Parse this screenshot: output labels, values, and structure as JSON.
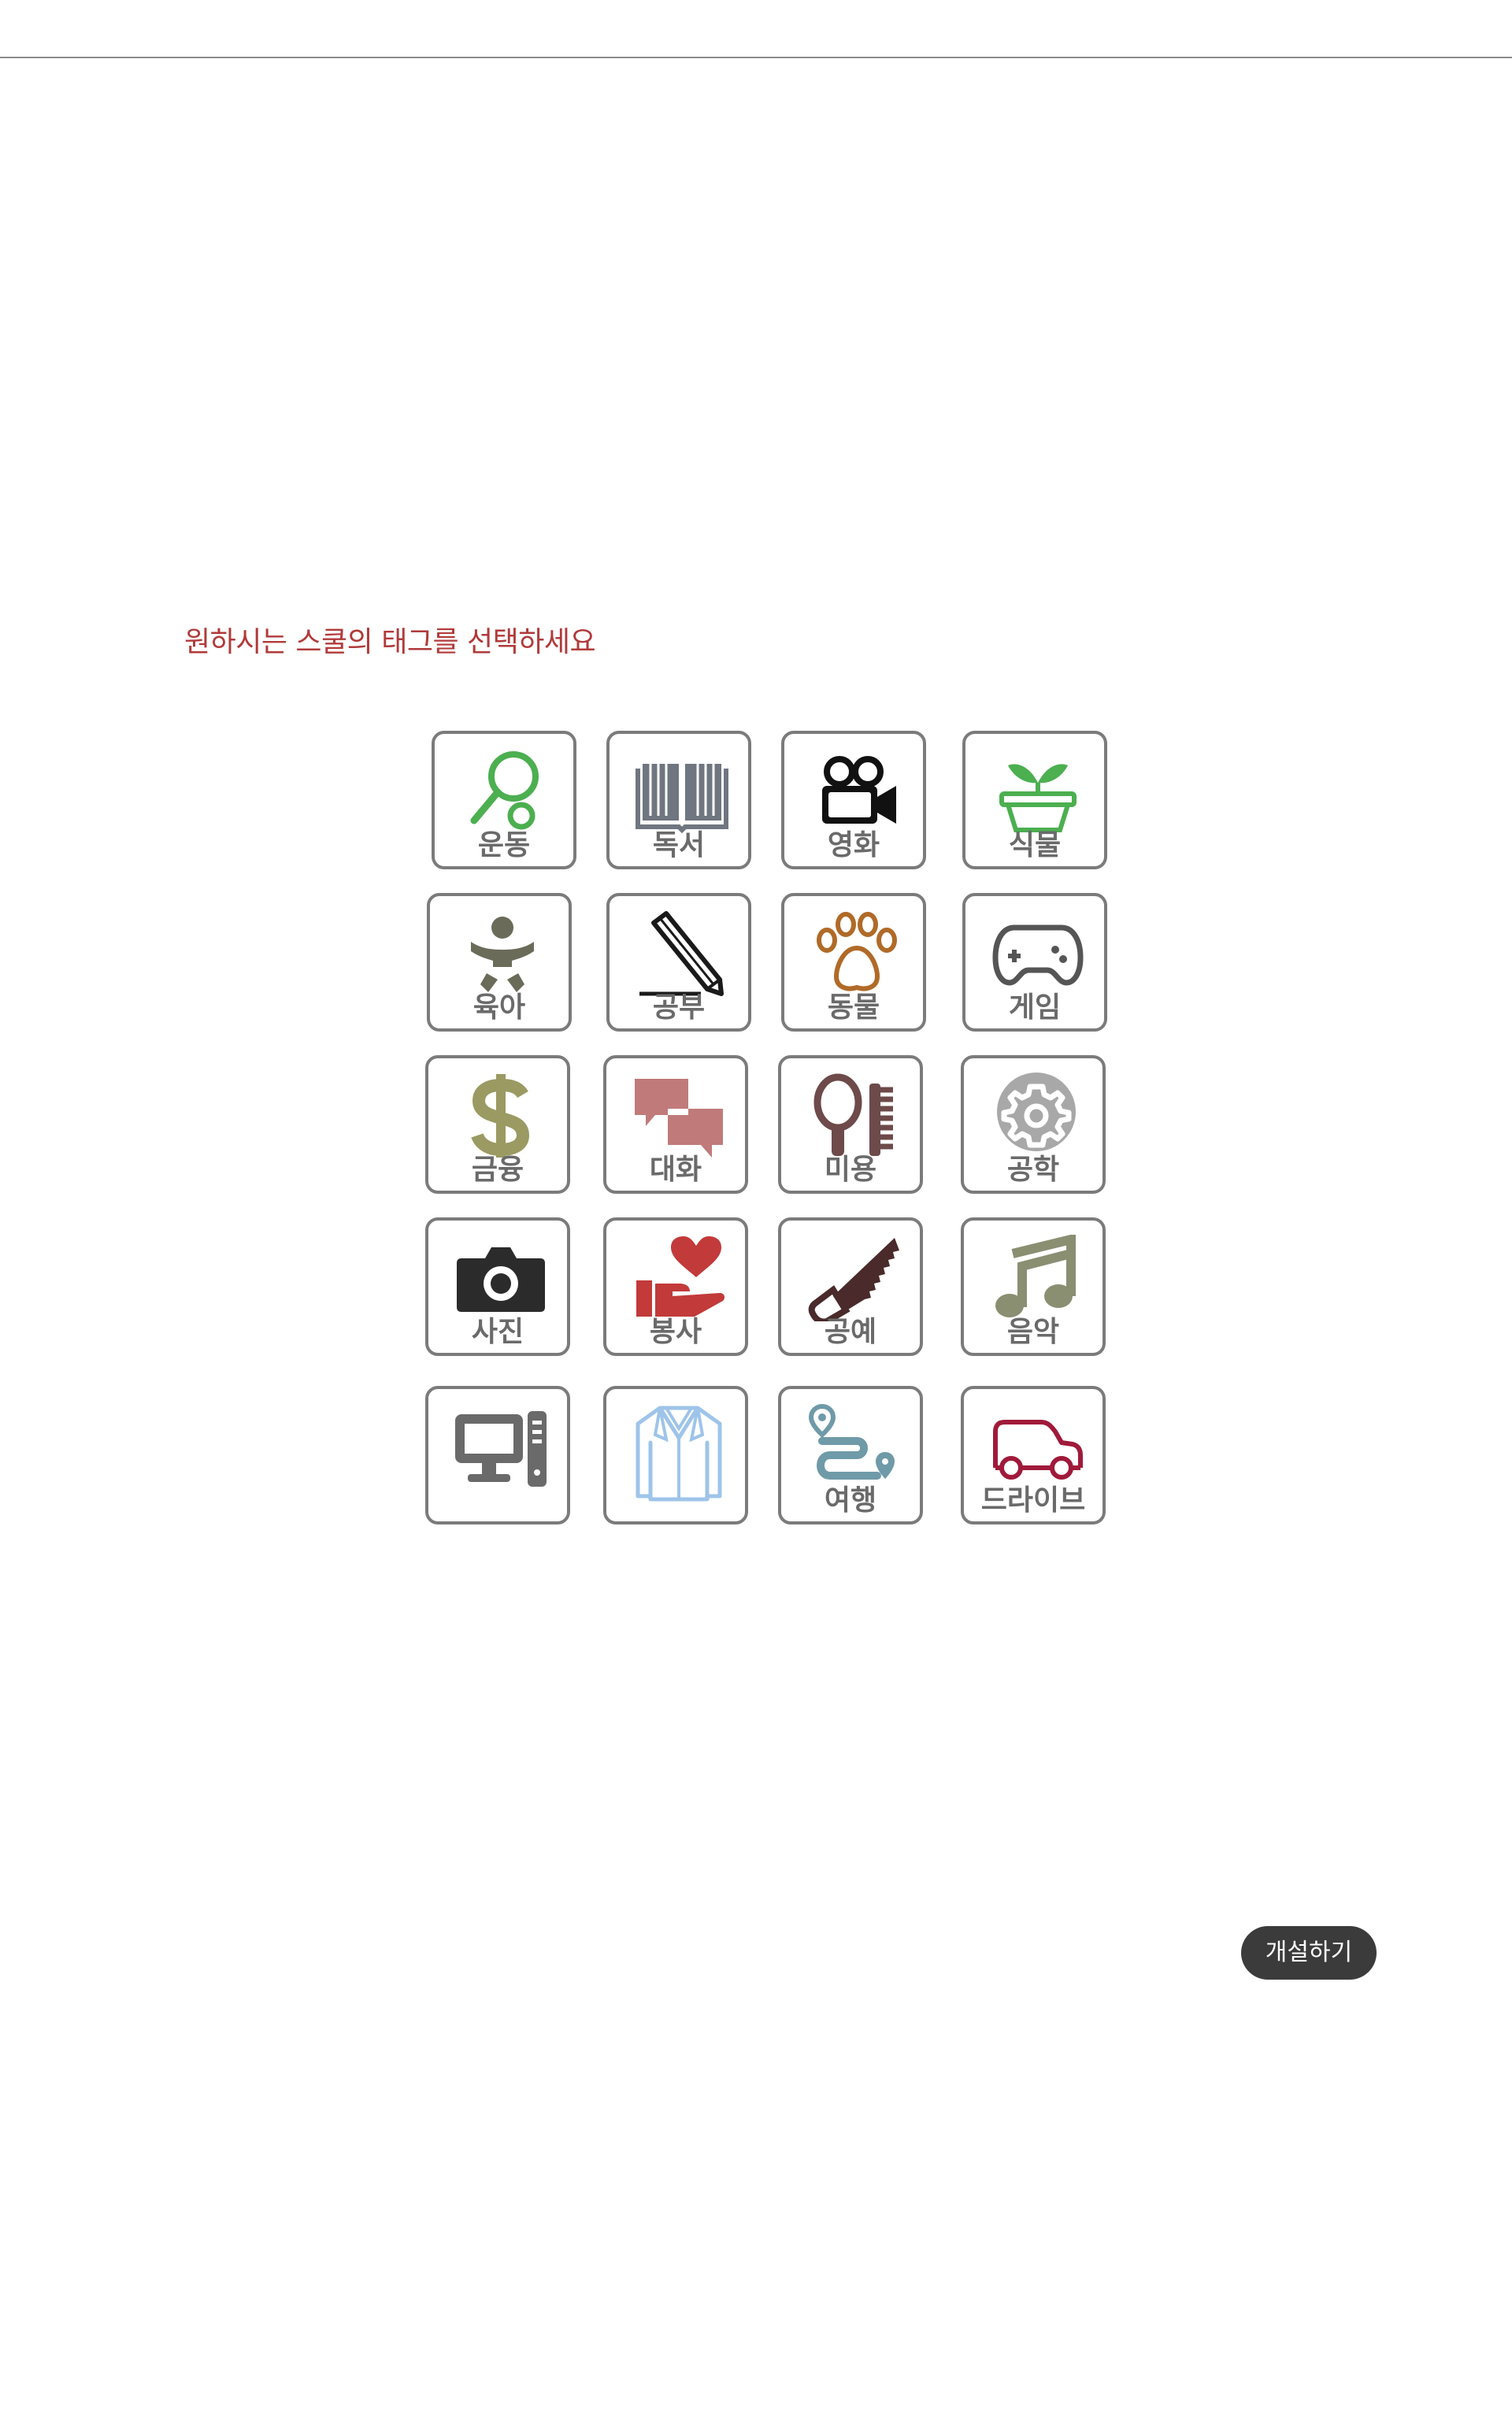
{
  "prompt_text": "원하시는 스쿨의 태그를 선택하세요",
  "tags": [
    {
      "label": "운동",
      "icon": "tennis-racket-icon",
      "color": "#4caf50"
    },
    {
      "label": "독서",
      "icon": "book-icon",
      "color": "#6f7680"
    },
    {
      "label": "영화",
      "icon": "movie-camera-icon",
      "color": "#111111"
    },
    {
      "label": "식물",
      "icon": "plant-pot-icon",
      "color": "#4caf50"
    },
    {
      "label": "육아",
      "icon": "baby-icon",
      "color": "#6b6b5a"
    },
    {
      "label": "공부",
      "icon": "pencil-icon",
      "color": "#1a1a1a"
    },
    {
      "label": "동물",
      "icon": "paw-icon",
      "color": "#b06a28"
    },
    {
      "label": "게임",
      "icon": "gamepad-icon",
      "color": "#555555"
    },
    {
      "label": "금융",
      "icon": "dollar-icon",
      "color": "#9a9a62"
    },
    {
      "label": "대화",
      "icon": "chat-bubbles-icon",
      "color": "#c07a7a"
    },
    {
      "label": "미용",
      "icon": "mirror-comb-icon",
      "color": "#6e4a4a"
    },
    {
      "label": "공학",
      "icon": "gear-icon",
      "color": "#a8a8a8"
    },
    {
      "label": "사진",
      "icon": "camera-icon",
      "color": "#2b2b2b"
    },
    {
      "label": "봉사",
      "icon": "heart-hand-icon",
      "color": "#c23a3a"
    },
    {
      "label": "공예",
      "icon": "saw-icon",
      "color": "#4a2a2a"
    },
    {
      "label": "음악",
      "icon": "music-note-icon",
      "color": "#8a8f72"
    },
    {
      "label": "",
      "icon": "desktop-computer-icon",
      "color": "#6a6a6a"
    },
    {
      "label": "",
      "icon": "jacket-icon",
      "color": "#9ec4ea"
    },
    {
      "label": "여행",
      "icon": "route-icon",
      "color": "#6f9aa8"
    },
    {
      "label": "드라이브",
      "icon": "car-icon",
      "color": "#a01a3a"
    }
  ],
  "create_button": "개설하기"
}
